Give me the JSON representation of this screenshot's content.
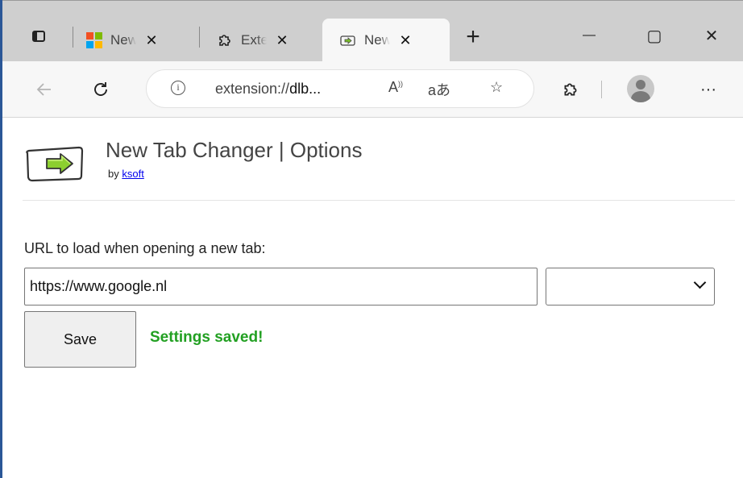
{
  "browser": {
    "tabs": [
      {
        "title": "New",
        "favicon": "microsoft-logo",
        "active": false
      },
      {
        "title": "Exte",
        "favicon": "puzzle-icon",
        "active": false
      },
      {
        "title": "New",
        "favicon": "arrow-tab-icon",
        "active": true
      }
    ],
    "tab_close_glyph": "✕",
    "new_tab_glyph": "+",
    "window_controls": {
      "minimize": "—",
      "maximize": "▢",
      "close": "✕"
    },
    "address": {
      "url_prefix": "extension://",
      "url_host": "dlb..."
    },
    "menu_glyph": "···"
  },
  "page": {
    "title": "New Tab Changer | Options",
    "by_label": "by",
    "author": "ksoft",
    "url_label": "URL to load when opening a new tab:",
    "url_value": "https://www.google.nl",
    "select_value": "",
    "save_label": "Save",
    "status": "Settings saved!"
  },
  "colors": {
    "status": "#22a022",
    "link": "#0000ee",
    "tabstrip": "#cfcfcf",
    "toolbar": "#f7f7f7"
  }
}
